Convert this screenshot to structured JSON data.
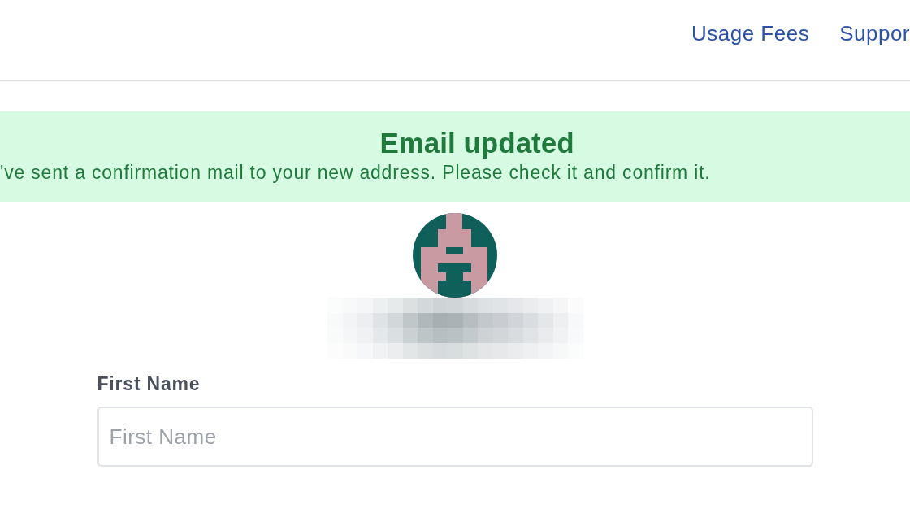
{
  "header": {
    "nav_links": [
      "Usage Fees",
      "Suppor"
    ]
  },
  "alert": {
    "kind": "success",
    "title": "Email updated",
    "message": "'ve sent a confirmation mail to your new address. Please check it and confirm it."
  },
  "form": {
    "fields": [
      {
        "label": "First Name",
        "placeholder": "First Name"
      }
    ]
  }
}
